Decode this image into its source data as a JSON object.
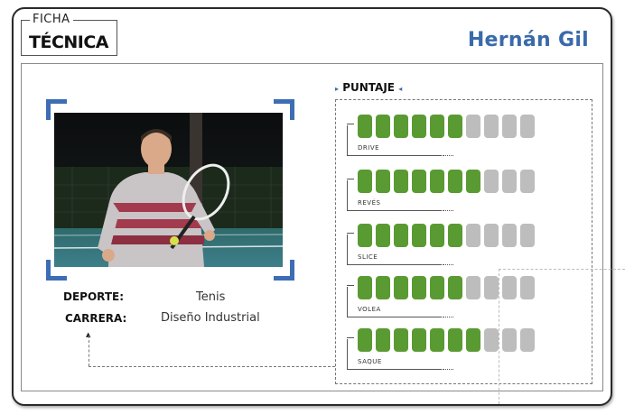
{
  "header": {
    "ficha_small": "FICHA",
    "ficha_large": "TÉCNICA",
    "player_name": "Hernán Gil"
  },
  "info": {
    "deporte_label": "DEPORTE:",
    "deporte_value": "Tenis",
    "carrera_label": "CARRERA:",
    "carrera_value": "Diseño Industrial"
  },
  "puntaje": {
    "title": "PUNTAJE",
    "max": 10,
    "skills": [
      {
        "label": "DRIVE",
        "value": 6
      },
      {
        "label": "REVÉS",
        "value": 7
      },
      {
        "label": "SLICE",
        "value": 6
      },
      {
        "label": "VOLEA",
        "value": 6
      },
      {
        "label": "SAQUE",
        "value": 7
      }
    ]
  },
  "colors": {
    "accent": "#3a6aab",
    "filled": "#5a9a32",
    "empty": "#bdbdbd"
  }
}
